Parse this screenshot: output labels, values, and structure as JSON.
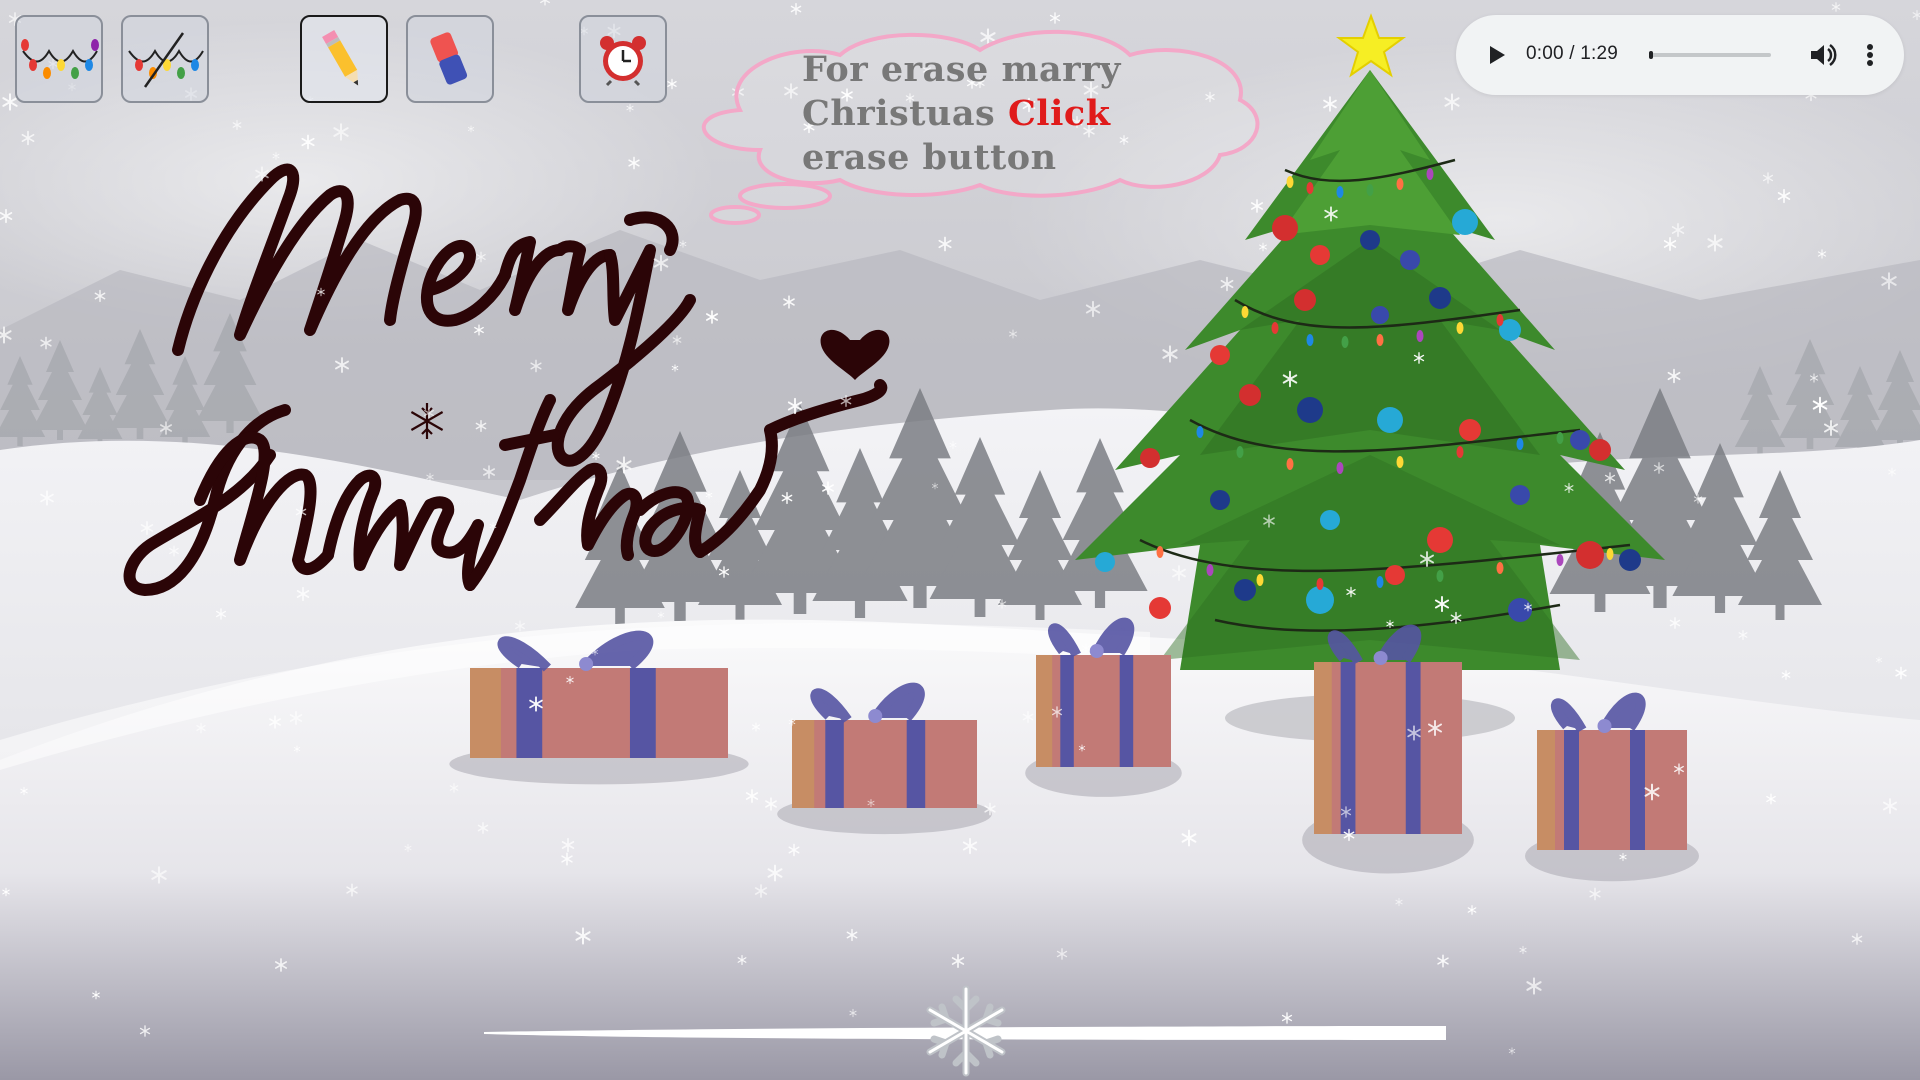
{
  "page": {
    "title": "Merry Christmas",
    "theme_colors": {
      "sky": "#c9c9cf",
      "snow": "#f2f2f5",
      "tree_green": "#3d8a2c",
      "bubble_outline": "#f3a8c8",
      "click_red": "#e01b1b",
      "lettering": "#2b0507"
    }
  },
  "toolbar": {
    "lights_on_label": "lights-on",
    "lights_off_label": "lights-off",
    "pencil_label": "pencil",
    "eraser_label": "eraser",
    "clock_label": "alarm-clock",
    "active_tool": "pencil"
  },
  "audio_player": {
    "current_time": "0:00",
    "separator": " / ",
    "duration": "1:29",
    "progress": 0.0,
    "icons": [
      "play-icon",
      "volume-icon",
      "more-options-icon"
    ]
  },
  "speech_bubble": {
    "line1": "For erase marry",
    "line2_prefix": "Christuas ",
    "line2_highlight": "Click",
    "line3": "erase button"
  },
  "greeting": {
    "word1": "Merry",
    "word2": "Christmas"
  },
  "scene_objects": {
    "tree": "christmas-tree",
    "star": "tree-star",
    "gifts": [
      "gift-box-1",
      "gift-box-2",
      "gift-box-3",
      "gift-box-4",
      "gift-box-5"
    ],
    "gift_colors": {
      "box": "#c27a76",
      "ribbon": "#5655a3"
    }
  },
  "bottom_slider": {
    "value": 0.4,
    "thumb_icon": "snowflake-icon"
  }
}
